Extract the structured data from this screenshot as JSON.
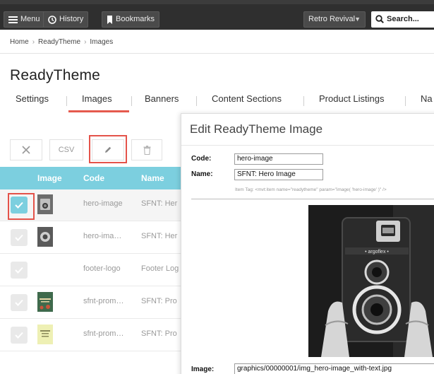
{
  "topbar": {
    "menu_label": "Menu",
    "history_label": "History",
    "bookmarks_label": "Bookmarks",
    "store_select": "Retro Revival",
    "search_placeholder": "Search..."
  },
  "breadcrumb": [
    "Home",
    "ReadyTheme",
    "Images"
  ],
  "page_title": "ReadyTheme",
  "tabs": [
    "Settings",
    "Images",
    "Banners",
    "Content Sections",
    "Product Listings",
    "Na"
  ],
  "active_tab": "Images",
  "toolbar": {
    "csv_label": "CSV"
  },
  "table": {
    "headers": [
      "Image",
      "Code",
      "Name"
    ],
    "rows": [
      {
        "code": "hero-image",
        "name": "SFNT: Her",
        "selected": true
      },
      {
        "code": "hero-ima…",
        "name": "SFNT: Her",
        "selected": false
      },
      {
        "code": "footer-logo",
        "name": "Footer Log",
        "selected": false
      },
      {
        "code": "sfnt-prom…",
        "name": "SFNT: Pro",
        "selected": false
      },
      {
        "code": "sfnt-prom…",
        "name": "SFNT: Pro",
        "selected": false
      }
    ]
  },
  "modal": {
    "title": "Edit ReadyTheme Image",
    "code_label": "Code:",
    "code_value": "hero-image",
    "name_label": "Name:",
    "name_value": "SFNT: Hero Image",
    "item_tag": "Item Tag: <mvt:item name=\"readytheme\" param=\"image( 'hero-image' )\" />",
    "image_label": "Image:",
    "image_value": "graphics/00000001/img_hero-image_with-text.jpg",
    "preview_text": "• argoflex •"
  },
  "colors": {
    "accent": "#7ccfdf",
    "highlight": "#e4534a",
    "tab_underline": "#e55a4e",
    "topbar": "#2f2f2f"
  }
}
